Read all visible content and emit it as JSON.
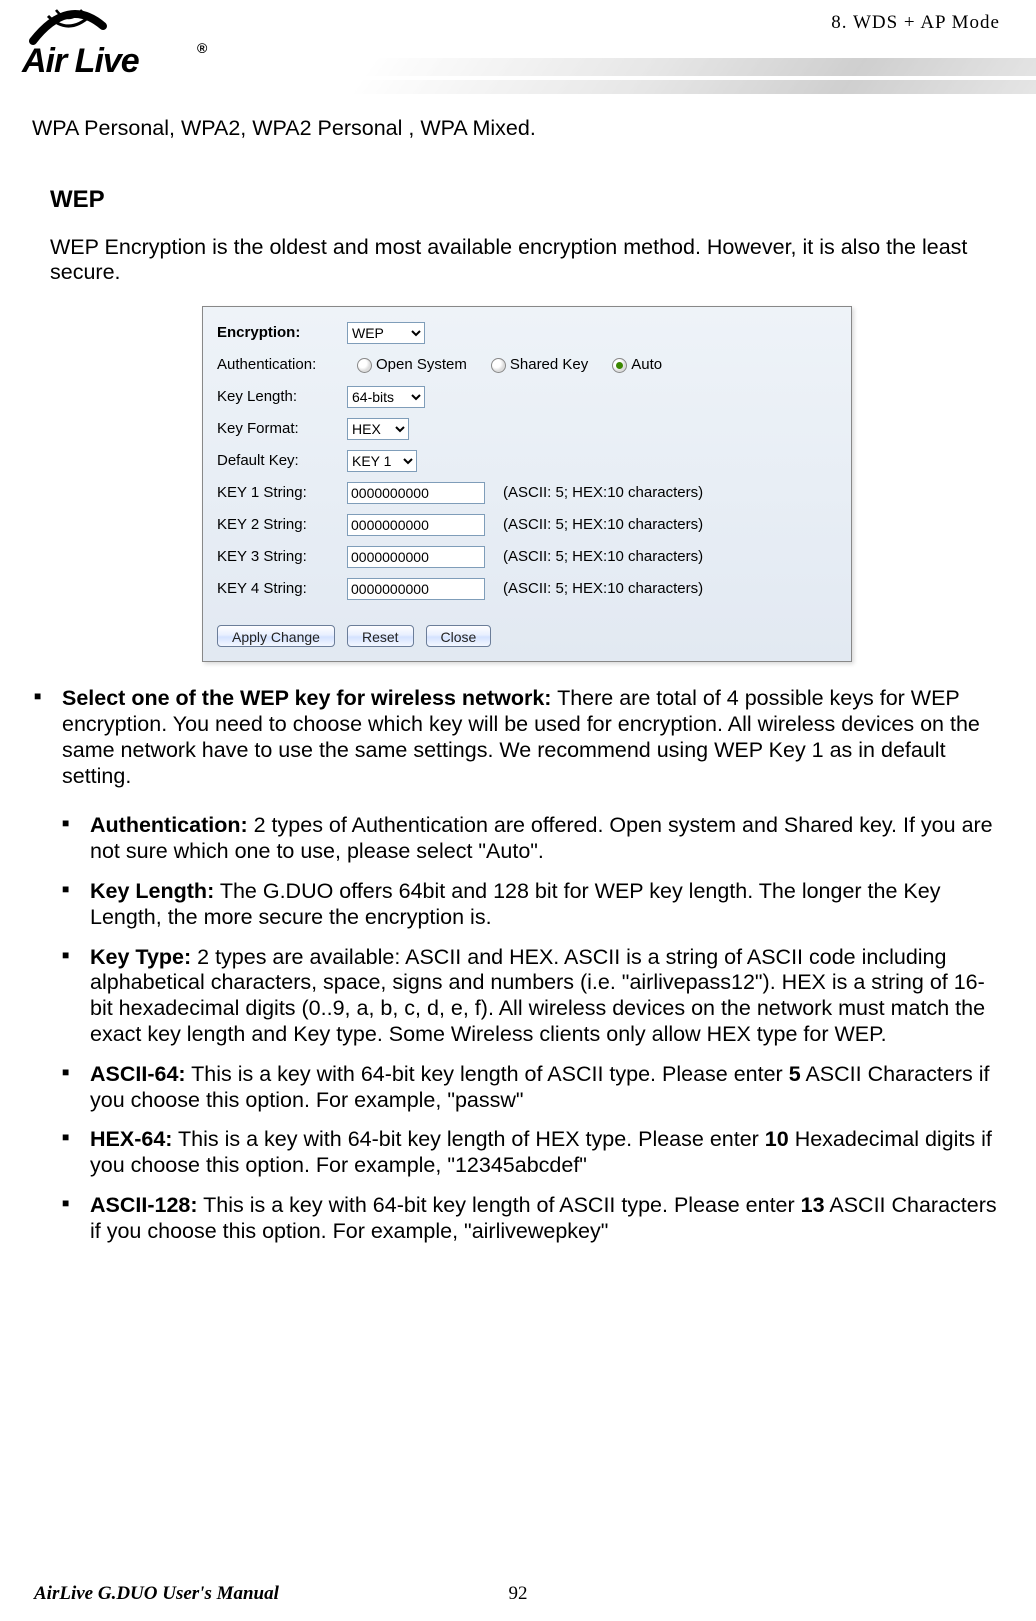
{
  "header": {
    "brand_main": "Air Live",
    "brand_reg": "®",
    "section": "8.  WDS  +  AP  Mode"
  },
  "intro_line": "WPA Personal, WPA2, WPA2 Personal , WPA Mixed.",
  "wep": {
    "title": "WEP",
    "desc": "WEP Encryption is the oldest and most available encryption method.    However, it is also the least secure."
  },
  "panel": {
    "labels": {
      "encryption": "Encryption:",
      "authentication": "Authentication:",
      "key_length": "Key Length:",
      "key_format": "Key Format:",
      "default_key": "Default Key:",
      "key1": "KEY 1 String:",
      "key2": "KEY 2 String:",
      "key3": "KEY 3 String:",
      "key4": "KEY 4 String:"
    },
    "select": {
      "encryption": "WEP",
      "key_length": "64-bits",
      "key_format": "HEX",
      "default_key": "KEY 1"
    },
    "auth": {
      "open": "Open System",
      "shared": "Shared Key",
      "auto": "Auto",
      "selected": "auto"
    },
    "keys": {
      "k1": "0000000000",
      "k2": "0000000000",
      "k3": "0000000000",
      "k4": "0000000000"
    },
    "hint": "(ASCII: 5; HEX:10 characters)",
    "buttons": {
      "apply": "Apply Change",
      "reset": "Reset",
      "close": "Close"
    }
  },
  "bullet_main": {
    "lead": "Select one of the WEP key for wireless network:",
    "rest": "    There are total of 4 possible keys for WEP encryption.    You need to choose which key will be used for encryption.    All wireless devices on the same network have to use the same settings.    We recommend using WEP Key 1 as in default setting."
  },
  "sub_bullets": {
    "auth": {
      "lead": "Authentication:",
      "rest": "    2 types of Authentication are offered.    Open system and Shared key.    If you are not sure which one to use, please select \"Auto\"."
    },
    "keylen": {
      "lead": "Key Length:",
      "rest": "    The G.DUO offers 64bit and 128 bit for WEP key length.    The longer the Key Length, the more secure the encryption is."
    },
    "keytype": {
      "lead": "Key Type:",
      "rest": "    2 types are available: ASCII and HEX.    ASCII is a string of ASCII code including alphabetical characters, space, signs and numbers (i.e. \"airlivepass12\").    HEX is a string of 16-bit hexadecimal digits (0..9, a, b, c, d, e, f).  All wireless devices on the network must match the exact key length and Key type.  Some Wireless clients only allow HEX type for WEP."
    },
    "ascii64": {
      "lead": "ASCII-64:",
      "mid": " This is a key with 64-bit key length of ASCII type.    Please enter ",
      "num": "5",
      "tail": " ASCII Characters if you choose this option. For example, \"passw\""
    },
    "hex64": {
      "lead": "HEX-64:",
      "mid": " This is a key with 64-bit key length of HEX type.    Please enter ",
      "num": "10",
      "tail": " Hexadecimal digits if you choose this option. For example, \"12345abcdef\""
    },
    "ascii128": {
      "lead": "ASCII-128:",
      "mid": " This is a key with 64-bit key length of ASCII type.    Please enter ",
      "num": "13",
      "tail": " ASCII Characters if you choose this option. For example, \"airlivewepkey\""
    }
  },
  "footer": {
    "manual": "AirLive G.DUO User's Manual",
    "page": "92"
  }
}
